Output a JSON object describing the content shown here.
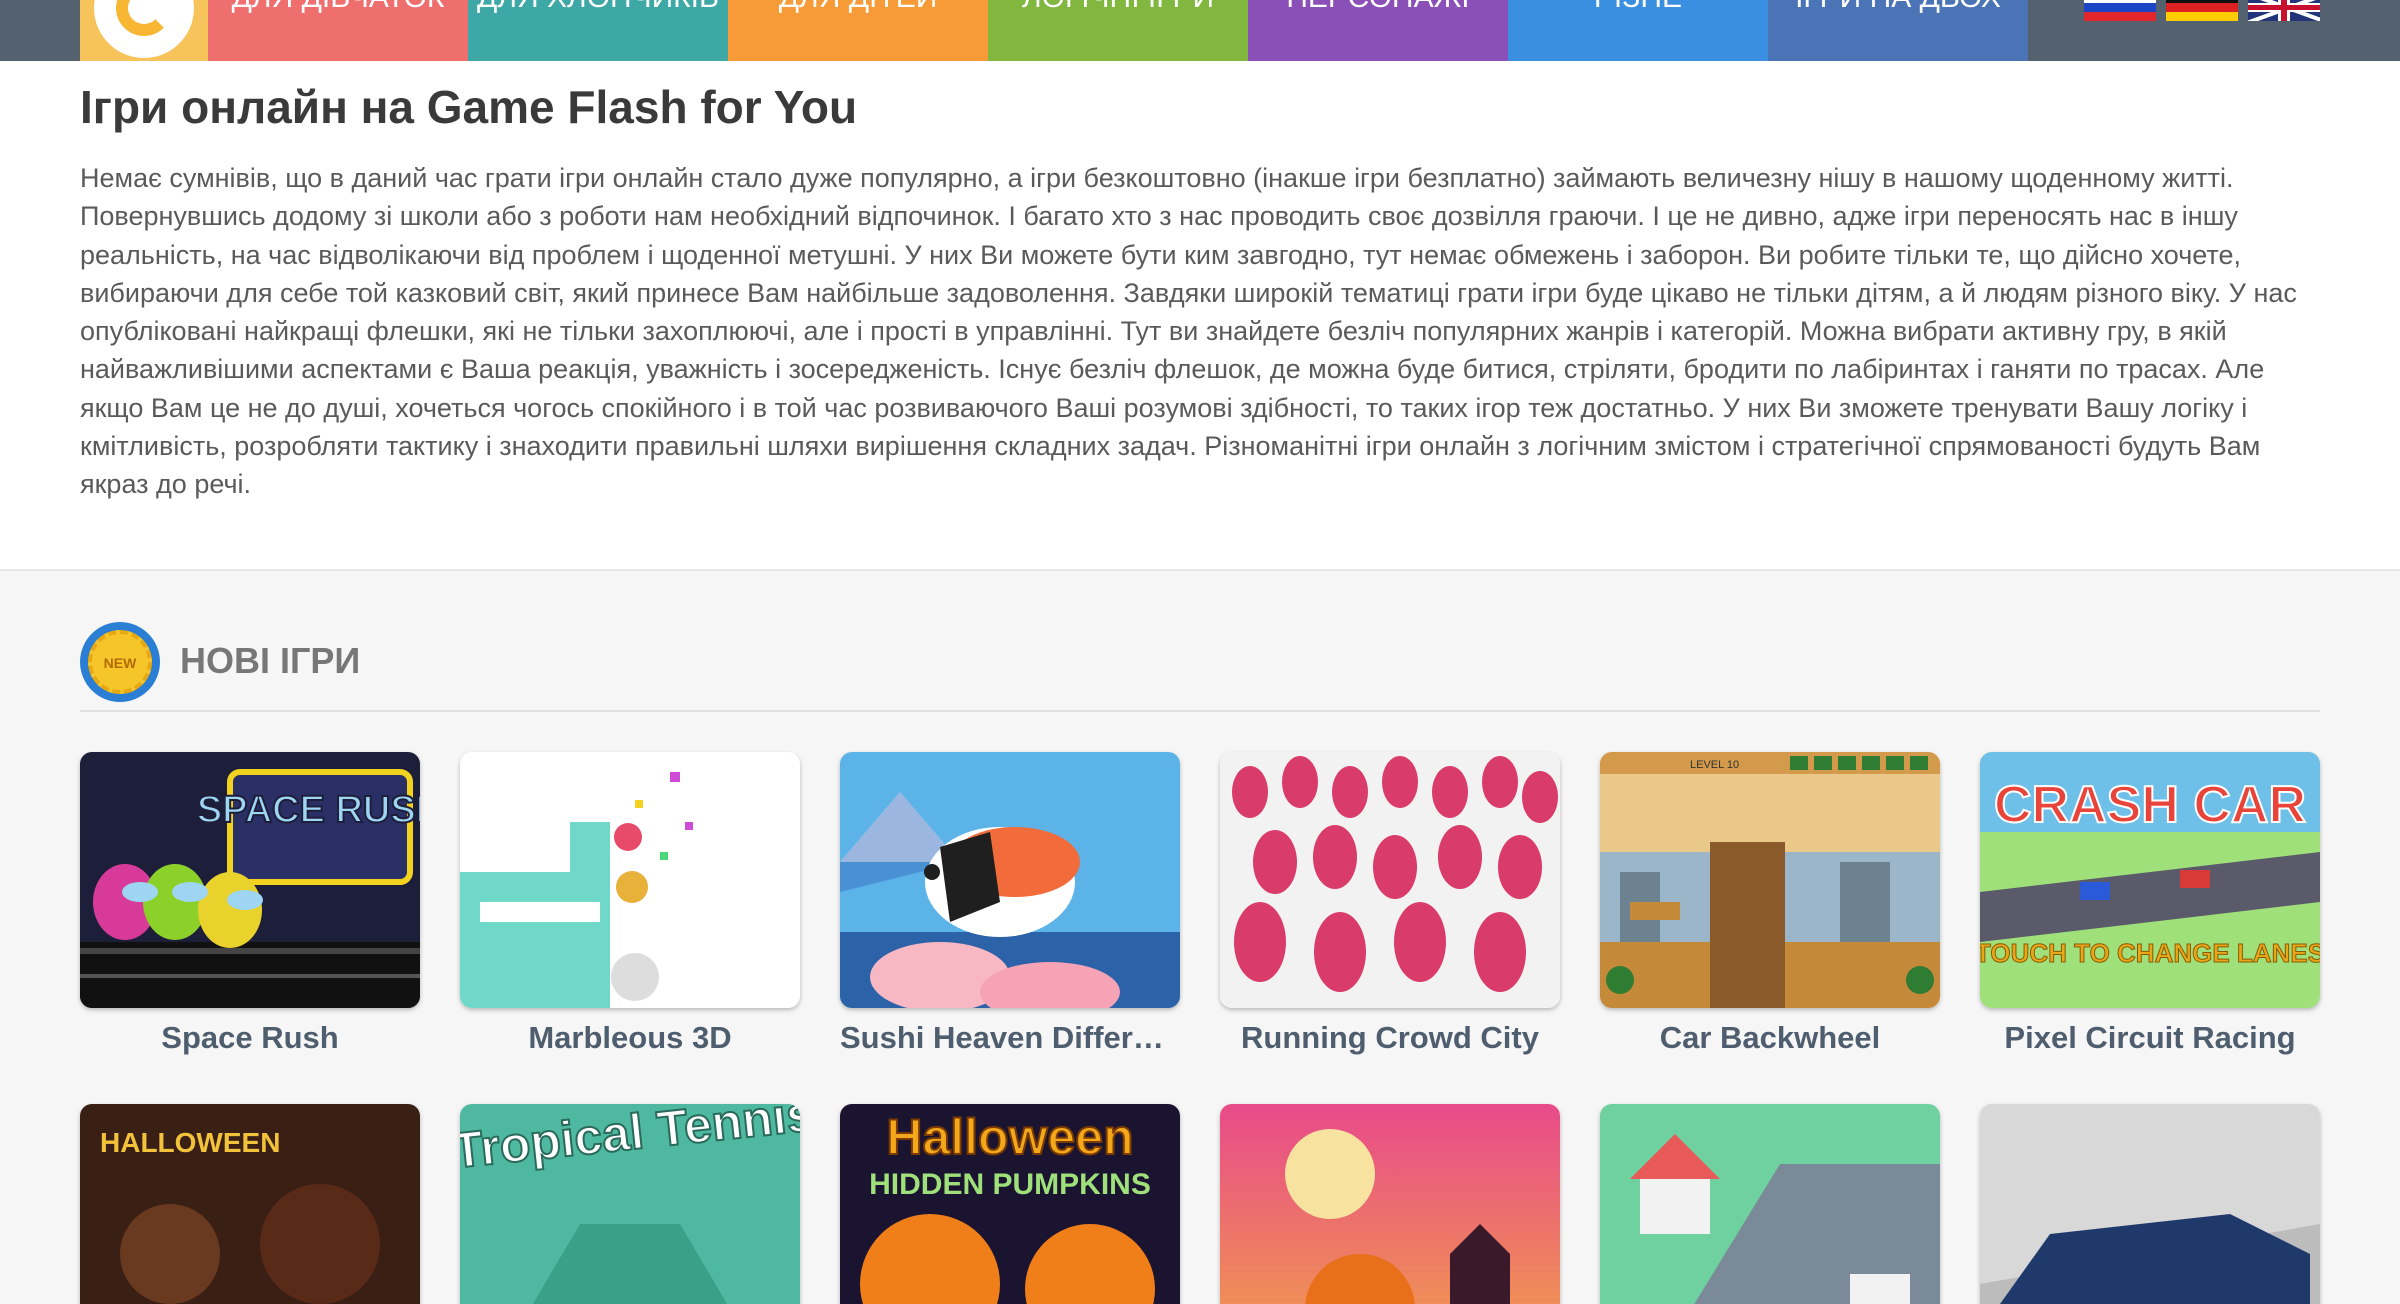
{
  "nav": {
    "logo_icon": "refresh-arrow-logo-icon",
    "items": [
      {
        "label": "Для дівчаток",
        "color": "#ef6f6f"
      },
      {
        "label": "Для хлопчиків",
        "color": "#3ea8a6"
      },
      {
        "label": "Для дітей",
        "color": "#f69b37"
      },
      {
        "label": "Логічні ігри",
        "color": "#81b63f"
      },
      {
        "label": "Персонажі",
        "color": "#8b4fb8"
      },
      {
        "label": "Різне",
        "color": "#3a8fe0"
      },
      {
        "label": "Ігри на двох",
        "color": "#4a74b5"
      }
    ],
    "languages": [
      "ru-flag-icon",
      "de-flag-icon",
      "gb-flag-icon"
    ]
  },
  "intro": {
    "title": "Ігри онлайн на Game Flash for You",
    "text": "Немає сумнівів, що в даний час грати ігри онлайн стало дуже популярно, а ігри безкоштовно (інакше ігри безплатно) займають величезну нішу в нашому щоденному житті. Повернувшись додому зі школи або з роботи нам необхідний відпочинок. І багато хто з нас проводить своє дозвілля граючи. І це не дивно, адже ігри переносять нас в іншу реальність, на час відволікаючи від проблем і щоденної метушні. У них Ви можете бути ким завгодно, тут немає обмежень і заборон. Ви робите тільки те, що дійсно хочете, вибираючи для себе той казковий світ, який принесе Вам найбільше задоволення. Завдяки широкій тематиці грати ігри буде цікаво не тільки дітям, а й людям різного віку. У нас опубліковані найкращі флешки, які не тільки захоплюючі, але і прості в управлінні. Тут ви знайдете безліч популярних жанрів і категорій. Можна вибрати активну гру, в якій найважливішими аспектами є Ваша реакція, уважність і зосередженість. Існує безліч флешок, де можна буде битися, стріляти, бродити по лабіринтах і ганяти по трасах. Але якщо Вам це не до душі, хочеться чогось спокійного і в той час розвиваючого Ваші розумові здібності, то таких ігор теж достатньо. У них Ви зможете тренувати Вашу логіку і кмітливість, розробляти тактику і знаходити правильні шляхи вирішення складних задач. Різноманітні ігри онлайн з логічним змістом і стратегічної спрямованості будуть Вам якраз до речі."
  },
  "new_games": {
    "badge_text": "NEW",
    "title": "НОВІ ІГРИ",
    "row1": [
      {
        "title": "Space Rush",
        "thumb_text": "SPACE RUSH"
      },
      {
        "title": "Marbleous 3D"
      },
      {
        "title": "Sushi Heaven Difference"
      },
      {
        "title": "Running Crowd City"
      },
      {
        "title": "Car Backwheel",
        "thumb_text": "LEVEL 10"
      },
      {
        "title": "Pixel Circuit Racing",
        "thumb_text": "CRASH CAR",
        "thumb_subtext": "TOUCH TO CHANGE LANES"
      }
    ],
    "row2": [
      {
        "thumb_text": "HALLOWEEN"
      },
      {
        "thumb_text": "Tropical Tennis"
      },
      {
        "thumb_text": "Halloween",
        "thumb_subtext": "HIDDEN PUMPKINS"
      },
      {},
      {},
      {}
    ]
  }
}
